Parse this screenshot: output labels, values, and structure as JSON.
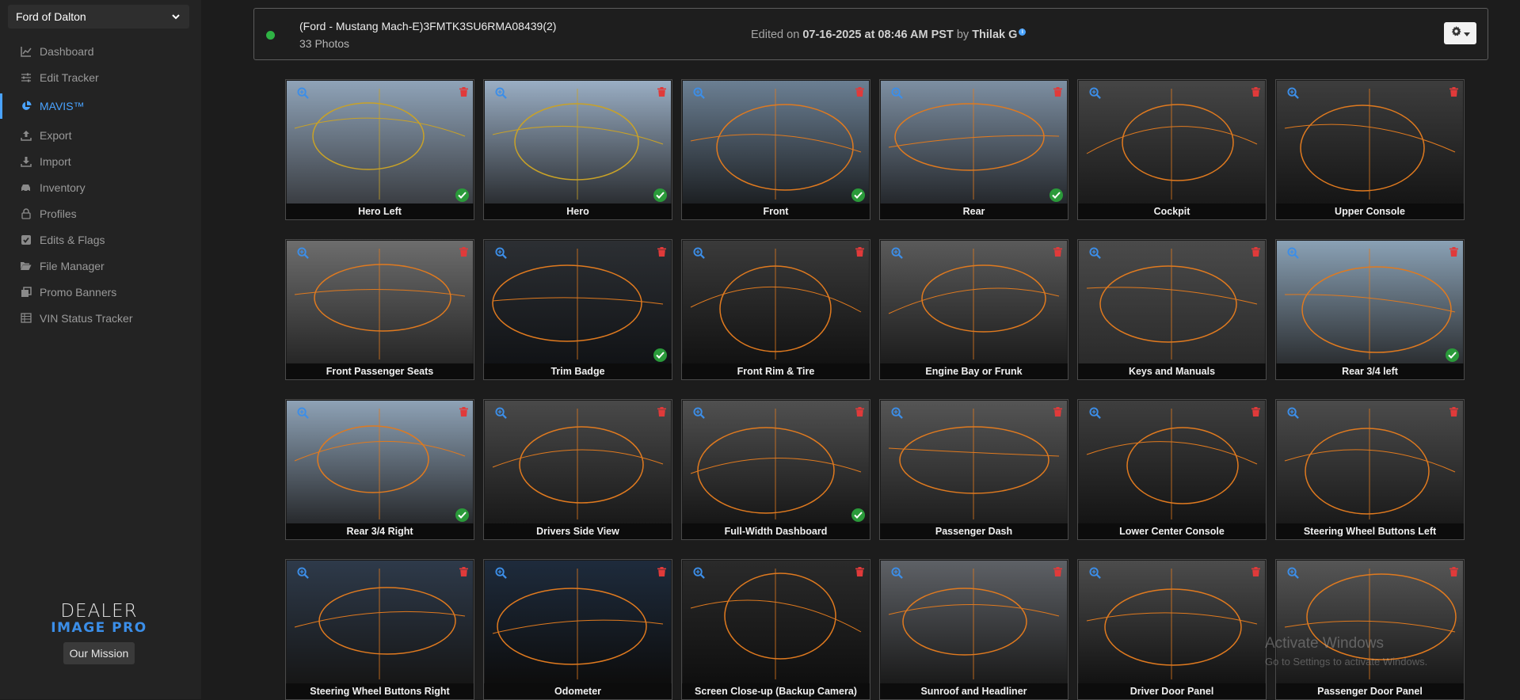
{
  "sidebar": {
    "dealer": "Ford of Dalton",
    "items": [
      {
        "label": "Dashboard",
        "icon": "chart-line-icon"
      },
      {
        "label": "Edit Tracker",
        "icon": "sliders-icon"
      },
      {
        "label": "MAVIS™",
        "icon": "pie-chart-icon",
        "active": true
      },
      {
        "label": "Export",
        "icon": "upload-icon"
      },
      {
        "label": "Import",
        "icon": "download-icon"
      },
      {
        "label": "Inventory",
        "icon": "car-icon"
      },
      {
        "label": "Profiles",
        "icon": "lock-icon"
      },
      {
        "label": "Edits & Flags",
        "icon": "check-square-icon"
      },
      {
        "label": "File Manager",
        "icon": "folder-open-icon"
      },
      {
        "label": "Promo Banners",
        "icon": "clone-icon"
      },
      {
        "label": "VIN Status Tracker",
        "icon": "table-icon"
      }
    ],
    "brand_line1": "DEALER",
    "brand_line2": "IMAGE PRO",
    "mission_button": "Our Mission"
  },
  "header": {
    "vehicle_title": "(Ford - Mustang Mach-E)3FMTK3SU6RMA08439(2)",
    "photo_count": "33 Photos",
    "edited_prefix": "Edited on",
    "edited_datetime": "07-16-2025 at 08:46 AM PST",
    "edited_by_prefix": "by",
    "edited_by": "Thilak G",
    "status_color": "#2fb344"
  },
  "photos": [
    {
      "label": "Hero Left",
      "checked": true
    },
    {
      "label": "Hero",
      "checked": true
    },
    {
      "label": "Front",
      "checked": true
    },
    {
      "label": "Rear",
      "checked": true
    },
    {
      "label": "Cockpit",
      "checked": false
    },
    {
      "label": "Upper Console",
      "checked": false
    },
    {
      "label": "Front Passenger Seats",
      "checked": false
    },
    {
      "label": "Trim Badge",
      "checked": true
    },
    {
      "label": "Front Rim & Tire",
      "checked": false
    },
    {
      "label": "Engine Bay or Frunk",
      "checked": false
    },
    {
      "label": "Keys and Manuals",
      "checked": false
    },
    {
      "label": "Rear 3/4 left",
      "checked": true
    },
    {
      "label": "Rear 3/4 Right",
      "checked": true
    },
    {
      "label": "Drivers Side View",
      "checked": false
    },
    {
      "label": "Full-Width Dashboard",
      "checked": true
    },
    {
      "label": "Passenger Dash",
      "checked": false
    },
    {
      "label": "Lower Center Console",
      "checked": false
    },
    {
      "label": "Steering Wheel Buttons Left",
      "checked": false
    },
    {
      "label": "Steering Wheel Buttons Right",
      "checked": false
    },
    {
      "label": "Odometer",
      "checked": false
    },
    {
      "label": "Screen Close-up (Backup Camera)",
      "checked": false
    },
    {
      "label": "Sunroof and Headliner",
      "checked": false
    },
    {
      "label": "Driver Door Panel",
      "checked": false
    },
    {
      "label": "Passenger Door Panel",
      "checked": false
    }
  ],
  "watermark": {
    "title": "Activate Windows",
    "subtitle": "Go to Settings to activate Windows."
  },
  "colors": {
    "accent": "#4aa3ff",
    "delete": "#e03a3a",
    "approved": "#2a9a3a",
    "outline_yellow": "#c9a227",
    "outline_orange": "#e07a1f"
  }
}
